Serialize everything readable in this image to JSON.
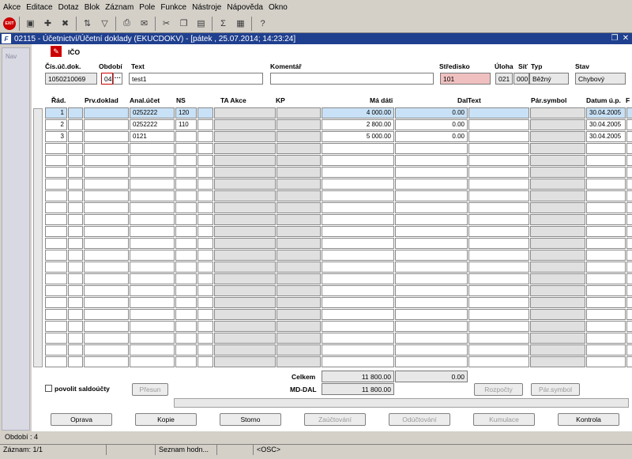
{
  "menu": [
    "Akce",
    "Editace",
    "Dotaz",
    "Blok",
    "Záznam",
    "Pole",
    "Funkce",
    "Nástroje",
    "Nápověda",
    "Okno"
  ],
  "toolbar_icons": [
    "exit-icon",
    "save-icon",
    "new-icon",
    "delete-icon",
    "filter-icon",
    "print-icon",
    "mail-icon",
    "cut-icon",
    "copy-icon",
    "paste-icon",
    "help-icon"
  ],
  "window": {
    "title": "02115 - Účetnictví/Účetní doklady (EKUCDOKV) - [pátek , 25.07.2014; 14:23:24]"
  },
  "nav_label": "Nav",
  "header": {
    "ico_label": "IČO",
    "labels": {
      "cis": "Čís.úč.dok.",
      "obdobi": "Období",
      "text": "Text",
      "komentar": "Komentář",
      "stredisko": "Středisko",
      "uloha": "Úloha",
      "sit": "Síť",
      "typ": "Typ",
      "stav": "Stav"
    },
    "values": {
      "cis": "1050210069",
      "obdobi": "04",
      "text": "test1",
      "komentar": "",
      "stredisko": "101",
      "uloha": "021",
      "sit": "000",
      "typ": "Běžný",
      "stav": "Chybový"
    }
  },
  "grid": {
    "headers": {
      "rad": "Řád.",
      "prv": "Prv.doklad",
      "anal": "Anal.účet",
      "ns": "NS",
      "ta": "TA Akce",
      "kp": "KP",
      "ma": "Má dáti",
      "dal": "Dal",
      "text": "Text",
      "par": "Pár.symbol",
      "datum": "Datum ú.p.",
      "extra": "F"
    },
    "rows": [
      {
        "rad": "1",
        "prv": "",
        "anal": "0252222",
        "ns": "120",
        "ta": "",
        "kp": "",
        "ma": "4 000.00",
        "dal": "0.00",
        "text": "",
        "par": "",
        "datum": "30.04.2005"
      },
      {
        "rad": "2",
        "prv": "",
        "anal": "0252222",
        "ns": "110",
        "ta": "",
        "kp": "",
        "ma": "2 800.00",
        "dal": "0.00",
        "text": "",
        "par": "",
        "datum": "30.04.2005"
      },
      {
        "rad": "3",
        "prv": "",
        "anal": "0121",
        "ns": "",
        "ta": "",
        "kp": "",
        "ma": "5 000.00",
        "dal": "0.00",
        "text": "",
        "par": "",
        "datum": "30.04.2005"
      }
    ]
  },
  "totals": {
    "celkem_label": "Celkem",
    "celkem_ma": "11 800.00",
    "celkem_dal": "0.00",
    "mddal_label": "MD-DAL",
    "mddal_val": "11 800.00"
  },
  "bottom": {
    "povolit": "povolit saldoúčty",
    "presun": "Přesun",
    "rozpocty": "Rozpočty",
    "parsymbol": "Pár.symbol"
  },
  "buttons": [
    "Oprava",
    "Kopie",
    "Storno",
    "Zaúčtování",
    "Odúčtování",
    "Kumulace",
    "Kontrola"
  ],
  "status": {
    "obdobi": "Období : 4",
    "zaznam": "Záznam: 1/1",
    "seznam": "Seznam hodn...",
    "osc": "<OSC>"
  }
}
